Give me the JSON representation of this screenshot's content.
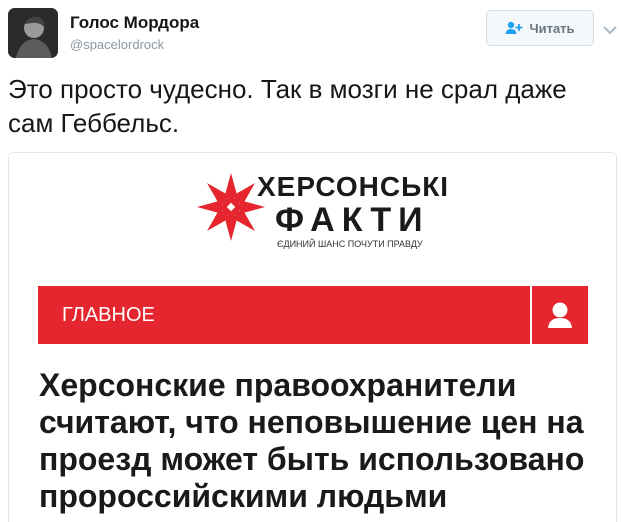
{
  "tweet": {
    "display_name": "Голос Мордора",
    "handle": "@spacelordrock",
    "follow_label": "Читать",
    "text": "Это просто чудесно. Так в мозги не срал даже сам Геббельс."
  },
  "card": {
    "logo_line1": "ХЕРСОНСЬКІ",
    "logo_line2": "ФАКТИ",
    "logo_tagline": "ЄДИНИЙ ШАНС ПОЧУТИ ПРАВДУ",
    "section_label": "ГЛАВНОЕ",
    "headline": "Херсонские правоохранители считают, что неповышение цен на проезд может быть использовано пророссийскими людьми"
  },
  "colors": {
    "brand_red": "#e6262e",
    "follow_blue": "#1da1f2",
    "text_dark": "#14171a",
    "muted": "#8899a6"
  },
  "icons": {
    "follow": "add-person-icon",
    "menu": "chevron-down-icon",
    "user": "user-icon",
    "logo": "star-ornament-icon"
  }
}
